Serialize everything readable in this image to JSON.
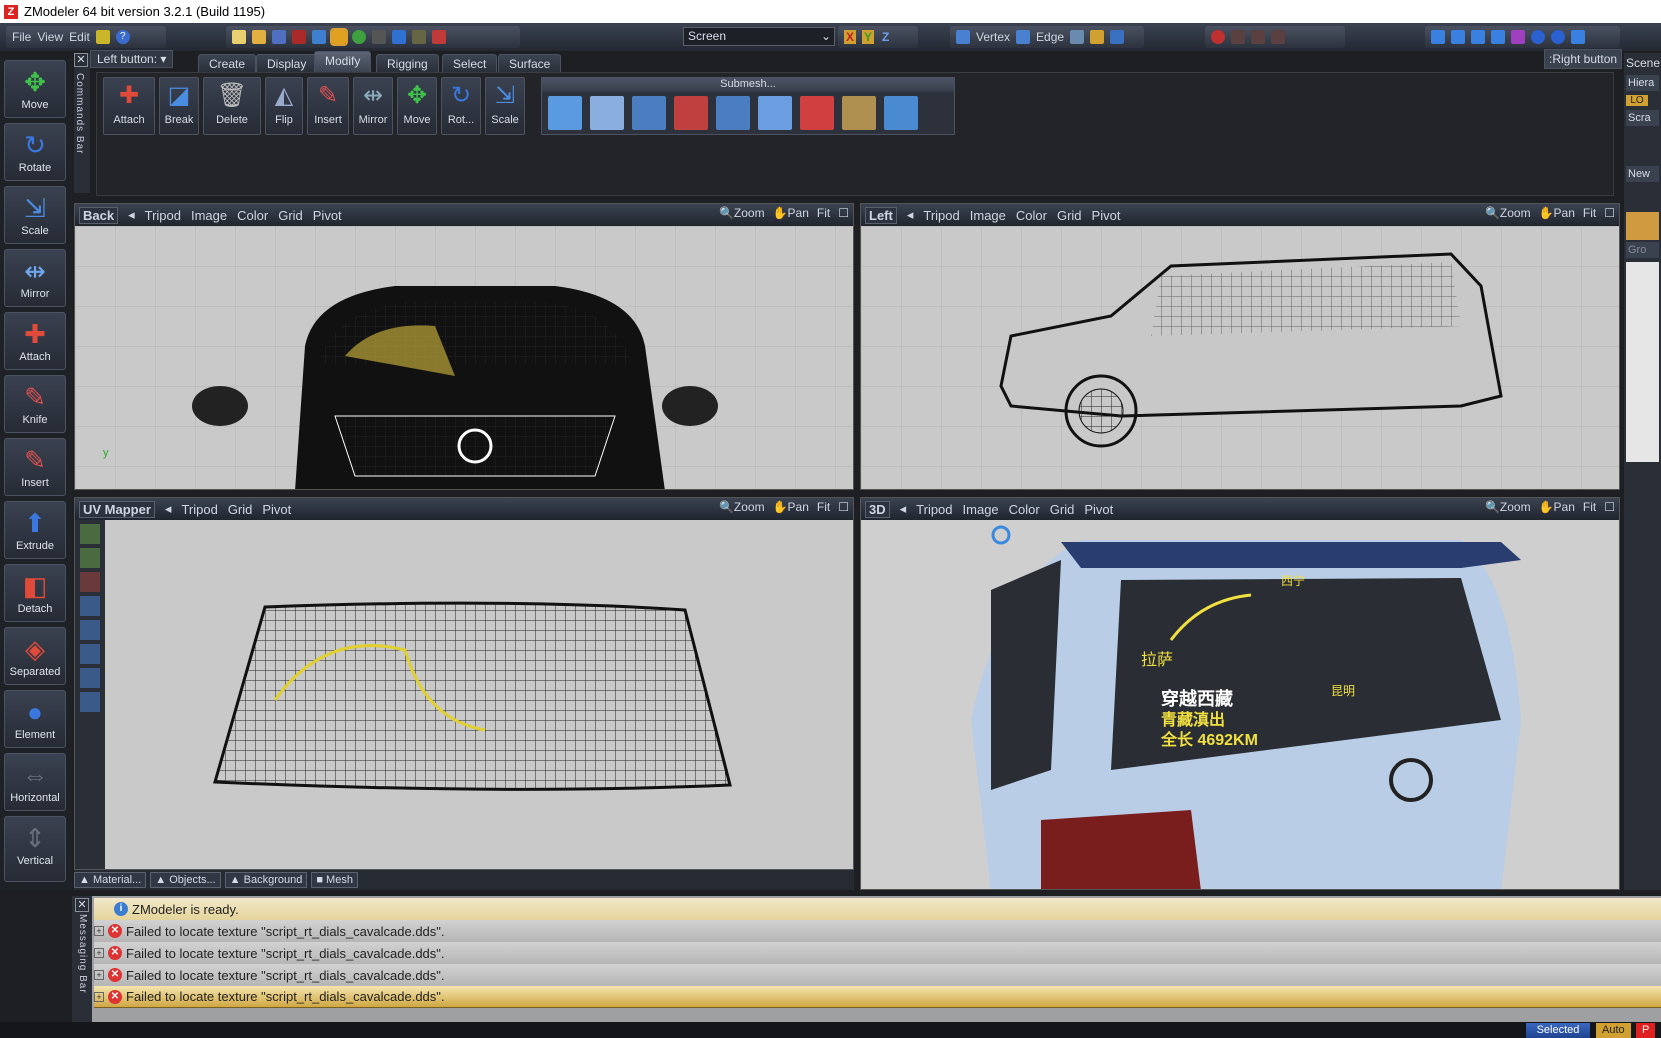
{
  "window": {
    "title": "ZModeler 64 bit version 3.2.1 (Build 1195)"
  },
  "menu": [
    {
      "label": "File"
    },
    {
      "label": "View"
    },
    {
      "label": "Edit"
    }
  ],
  "toolbar": {
    "space_select": "Screen",
    "axes": [
      "X",
      "Y",
      "Z"
    ],
    "vertex": "Vertex",
    "edge": "Edge",
    "left_button": "Left button:",
    "right_button": ":Right button"
  },
  "left_tools": [
    {
      "label": "Move",
      "glyph": "✥",
      "color": "#3fc24a"
    },
    {
      "label": "Rotate",
      "glyph": "↻",
      "color": "#3a78e0"
    },
    {
      "label": "Scale",
      "glyph": "⇲",
      "color": "#4a8de0"
    },
    {
      "label": "Mirror",
      "glyph": "⇹",
      "color": "#6ea6ea"
    },
    {
      "label": "Attach",
      "glyph": "✚",
      "color": "#e04a3a"
    },
    {
      "label": "Knife",
      "glyph": "✎",
      "color": "#e05050"
    },
    {
      "label": "Insert",
      "glyph": "✎",
      "color": "#e05050"
    },
    {
      "label": "Extrude",
      "glyph": "⬆",
      "color": "#3a78e0"
    },
    {
      "label": "Detach",
      "glyph": "◧",
      "color": "#e04a3a"
    },
    {
      "label": "Separated",
      "glyph": "◈",
      "color": "#e04a3a"
    },
    {
      "label": "Element",
      "glyph": "●",
      "color": "#3a78e0"
    },
    {
      "label": "Horizontal",
      "glyph": "⇔",
      "color": "#6a7080"
    },
    {
      "label": "Vertical",
      "glyph": "⇕",
      "color": "#6a7080"
    }
  ],
  "command_tabs": [
    {
      "label": "Create"
    },
    {
      "label": "Display"
    },
    {
      "label": "Modify",
      "active": true
    },
    {
      "label": "Rigging"
    },
    {
      "label": "Select"
    },
    {
      "label": "Surface"
    }
  ],
  "commands_bar_label": "Commands Bar",
  "commands": [
    {
      "label": "Attach",
      "glyph": "✚"
    },
    {
      "label": "Break",
      "glyph": "◪"
    },
    {
      "label": "Delete",
      "glyph": "🗑"
    },
    {
      "label": "Flip",
      "glyph": "◭"
    },
    {
      "label": "Insert",
      "glyph": "✎"
    },
    {
      "label": "Mirror",
      "glyph": "⇹"
    },
    {
      "label": "Move",
      "glyph": "✥"
    },
    {
      "label": "Rot...",
      "glyph": "↻"
    },
    {
      "label": "Scale",
      "glyph": "⇲"
    }
  ],
  "submesh": {
    "title": "Submesh..."
  },
  "viewports": [
    {
      "name": "Back",
      "items": [
        "Tripod",
        "Image",
        "Color",
        "Grid",
        "Pivot"
      ]
    },
    {
      "name": "Left",
      "items": [
        "Tripod",
        "Image",
        "Color",
        "Grid",
        "Pivot"
      ]
    },
    {
      "name": "UV Mapper",
      "items": [
        "Tripod",
        "Grid",
        "Pivot"
      ]
    },
    {
      "name": "3D",
      "items": [
        "Tripod",
        "Image",
        "Color",
        "Grid",
        "Pivot"
      ]
    }
  ],
  "viewport_tools": {
    "zoom": "Zoom",
    "pan": "Pan",
    "fit": "Fit"
  },
  "uv_bottom_tabs": [
    {
      "label": "Material..."
    },
    {
      "label": "Objects..."
    },
    {
      "label": "Background"
    },
    {
      "label": "Mesh"
    }
  ],
  "scene_panel": {
    "title": "Scene",
    "hierarchy": "Hiera",
    "lo": "LO",
    "scratch": "Scra",
    "new": "New",
    "group": "Gro"
  },
  "messaging_bar_label": "Messaging Bar",
  "messages": [
    {
      "type": "info",
      "text": "ZModeler is ready."
    },
    {
      "type": "error",
      "text": "Failed to locate texture \"script_rt_dials_cavalcade.dds\"."
    },
    {
      "type": "error",
      "text": "Failed to locate texture \"script_rt_dials_cavalcade.dds\"."
    },
    {
      "type": "error",
      "text": "Failed to locate texture \"script_rt_dials_cavalcade.dds\"."
    },
    {
      "type": "error",
      "text": "Failed to locate texture \"script_rt_dials_cavalcade.dds\".",
      "selected": true
    }
  ],
  "status": {
    "selected": "Selected",
    "auto": "Auto",
    "p": "P"
  },
  "decal": {
    "line1": "穿越西藏",
    "line2": "青藏滇出",
    "line3": "全长 4692KM",
    "city1": "拉萨",
    "city2": "昆明",
    "city3": "西宁"
  }
}
